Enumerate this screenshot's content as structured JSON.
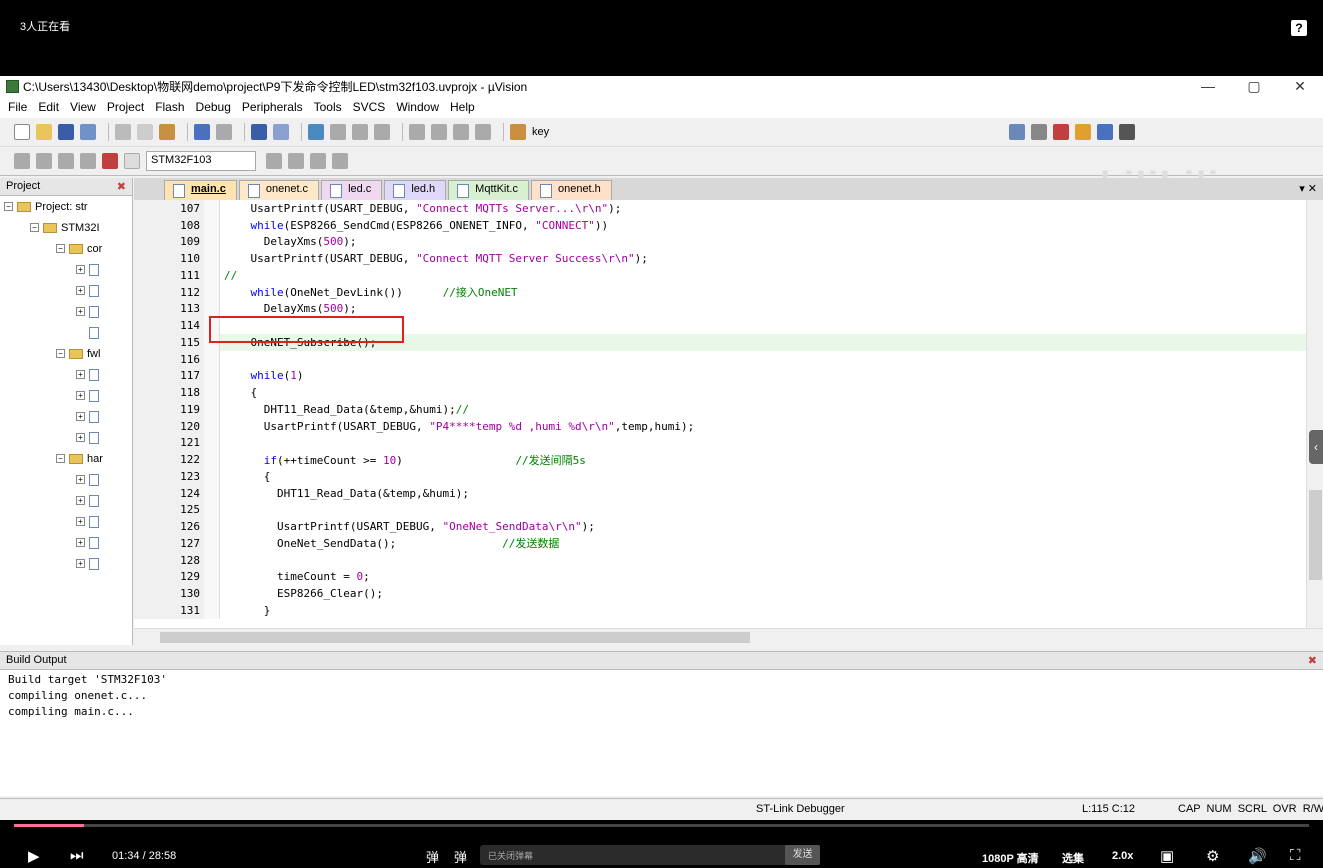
{
  "overlay": {
    "watchers": "3人正在看",
    "help": "?"
  },
  "window": {
    "title": "C:\\Users\\13430\\Desktop\\物联网demo\\project\\P9下发命令控制LED\\stm32f103.uvprojx - µVision",
    "min": "—",
    "max": "▢",
    "close": "✕"
  },
  "menu": [
    "File",
    "Edit",
    "View",
    "Project",
    "Flash",
    "Debug",
    "Peripherals",
    "Tools",
    "SVCS",
    "Window",
    "Help"
  ],
  "toolbar": {
    "find_text": "key",
    "target": "STM32F103"
  },
  "project_panel": {
    "title": "Project",
    "items": [
      "Project: str",
      "STM32I",
      "cor",
      "fwl",
      "har"
    ]
  },
  "tabs": [
    "main.c",
    "onenet.c",
    "led.c",
    "led.h",
    "MqttKit.c",
    "onenet.h"
  ],
  "code": [
    {
      "n": "107",
      "t": "    UsartPrintf(USART_DEBUG, \"Connect MQTTs Server...\\r\\n\");"
    },
    {
      "n": "108",
      "t": "    while(ESP8266_SendCmd(ESP8266_ONENET_INFO, \"CONNECT\"))"
    },
    {
      "n": "109",
      "t": "      DelayXms(500);"
    },
    {
      "n": "110",
      "t": "    UsartPrintf(USART_DEBUG, \"Connect MQTT Server Success\\r\\n\");"
    },
    {
      "n": "111",
      "t": "//"
    },
    {
      "n": "112",
      "t": "    while(OneNet_DevLink())      //接入OneNET"
    },
    {
      "n": "113",
      "t": "      DelayXms(500);"
    },
    {
      "n": "114",
      "t": ""
    },
    {
      "n": "115",
      "t": "    OneNET_Subscribe();"
    },
    {
      "n": "116",
      "t": ""
    },
    {
      "n": "117",
      "t": "    while(1)"
    },
    {
      "n": "118",
      "t": "    {"
    },
    {
      "n": "119",
      "t": "      DHT11_Read_Data(&temp,&humi);//"
    },
    {
      "n": "120",
      "t": "      UsartPrintf(USART_DEBUG, \"P4****temp %d ,humi %d\\r\\n\",temp,humi);"
    },
    {
      "n": "121",
      "t": ""
    },
    {
      "n": "122",
      "t": "      if(++timeCount >= 10)                 //发送间隔5s"
    },
    {
      "n": "123",
      "t": "      {"
    },
    {
      "n": "124",
      "t": "        DHT11_Read_Data(&temp,&humi);"
    },
    {
      "n": "125",
      "t": ""
    },
    {
      "n": "126",
      "t": "        UsartPrintf(USART_DEBUG, \"OneNet_SendData\\r\\n\");"
    },
    {
      "n": "127",
      "t": "        OneNet_SendData();                //发送数据"
    },
    {
      "n": "128",
      "t": ""
    },
    {
      "n": "129",
      "t": "        timeCount = 0;"
    },
    {
      "n": "130",
      "t": "        ESP8266_Clear();"
    },
    {
      "n": "131",
      "t": "      }"
    }
  ],
  "build_output": {
    "title": "Build Output",
    "lines": [
      "Build target 'STM32F103'",
      "compiling onenet.c...",
      "compiling main.c..."
    ]
  },
  "status": {
    "debugger": "ST-Link Debugger",
    "position": "L:115 C:12",
    "flags": "CAP  NUM  SCRL  OVR  R/W"
  },
  "player": {
    "time": "01:34 / 28:58",
    "danmaku_placeholder": "已关闭弹幕",
    "send": "发送",
    "quality": "1080P 高清",
    "episodes": "选集",
    "speed": "2.0x",
    "progress": 0.054
  }
}
